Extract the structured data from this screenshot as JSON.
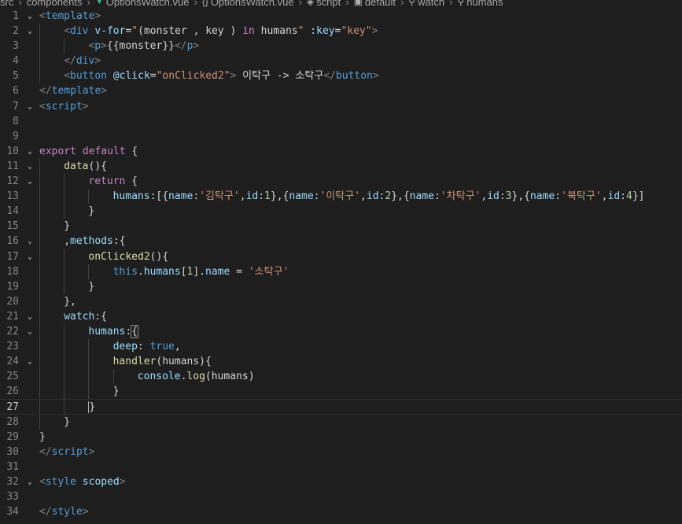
{
  "breadcrumb": [
    "src",
    "components",
    "OptionsWatch.vue",
    "OptionsWatch.vue",
    "script",
    "default",
    "watch",
    "humans"
  ],
  "lines": [
    {
      "n": "1",
      "fold": true,
      "indent": 0,
      "tokens": [
        [
          "br",
          "<"
        ],
        [
          "tag",
          "template"
        ],
        [
          "br",
          ">"
        ]
      ]
    },
    {
      "n": "2",
      "fold": true,
      "indent": 1,
      "tokens": [
        [
          "br",
          "<"
        ],
        [
          "tag",
          "div"
        ],
        [
          "txt",
          " "
        ],
        [
          "attr",
          "v-for"
        ],
        [
          "txt",
          "="
        ],
        [
          "str",
          "\""
        ],
        [
          "txt",
          "(monster , key ) "
        ],
        [
          "kw",
          "in"
        ],
        [
          "txt",
          " humans"
        ],
        [
          "str",
          "\""
        ],
        [
          "txt",
          " "
        ],
        [
          "attr",
          ":key"
        ],
        [
          "txt",
          "="
        ],
        [
          "str",
          "\"key\""
        ],
        [
          "br",
          ">"
        ]
      ]
    },
    {
      "n": "3",
      "fold": false,
      "indent": 2,
      "tokens": [
        [
          "br",
          "<"
        ],
        [
          "tag",
          "p"
        ],
        [
          "br",
          ">"
        ],
        [
          "txt",
          "{{monster}}"
        ],
        [
          "br",
          "</"
        ],
        [
          "tag",
          "p"
        ],
        [
          "br",
          ">"
        ]
      ]
    },
    {
      "n": "4",
      "fold": false,
      "indent": 1,
      "tokens": [
        [
          "br",
          "</"
        ],
        [
          "tag",
          "div"
        ],
        [
          "br",
          ">"
        ]
      ]
    },
    {
      "n": "5",
      "fold": false,
      "indent": 1,
      "tokens": [
        [
          "br",
          "<"
        ],
        [
          "tag",
          "button"
        ],
        [
          "txt",
          " "
        ],
        [
          "attr",
          "@click"
        ],
        [
          "txt",
          "="
        ],
        [
          "str",
          "\"onClicked2\""
        ],
        [
          "br",
          ">"
        ],
        [
          "txt",
          " 이탁구 -> 소탁구"
        ],
        [
          "br",
          "</"
        ],
        [
          "tag",
          "button"
        ],
        [
          "br",
          ">"
        ]
      ]
    },
    {
      "n": "6",
      "fold": false,
      "indent": 0,
      "tokens": [
        [
          "br",
          "</"
        ],
        [
          "tag",
          "template"
        ],
        [
          "br",
          ">"
        ]
      ]
    },
    {
      "n": "7",
      "fold": true,
      "indent": 0,
      "tokens": [
        [
          "br",
          "<"
        ],
        [
          "tag",
          "script"
        ],
        [
          "br",
          ">"
        ]
      ]
    },
    {
      "n": "8",
      "fold": false,
      "indent": 0,
      "tokens": []
    },
    {
      "n": "9",
      "fold": false,
      "indent": 0,
      "tokens": []
    },
    {
      "n": "10",
      "fold": true,
      "indent": 0,
      "tokens": [
        [
          "kw",
          "export"
        ],
        [
          "txt",
          " "
        ],
        [
          "kw",
          "default"
        ],
        [
          "txt",
          " {"
        ]
      ]
    },
    {
      "n": "11",
      "fold": true,
      "indent": 1,
      "tokens": [
        [
          "fn",
          "data"
        ],
        [
          "txt",
          "(){"
        ]
      ]
    },
    {
      "n": "12",
      "fold": true,
      "indent": 2,
      "tokens": [
        [
          "kw",
          "return"
        ],
        [
          "txt",
          " {"
        ]
      ]
    },
    {
      "n": "13",
      "fold": false,
      "indent": 3,
      "tokens": [
        [
          "prop",
          "humans"
        ],
        [
          "txt",
          ":[{"
        ],
        [
          "prop",
          "name"
        ],
        [
          "txt",
          ":"
        ],
        [
          "str",
          "'김탁구'"
        ],
        [
          "txt",
          ","
        ],
        [
          "prop",
          "id"
        ],
        [
          "txt",
          ":"
        ],
        [
          "num",
          "1"
        ],
        [
          "txt",
          "},{"
        ],
        [
          "prop",
          "name"
        ],
        [
          "txt",
          ":"
        ],
        [
          "str",
          "'이탁구'"
        ],
        [
          "txt",
          ","
        ],
        [
          "prop",
          "id"
        ],
        [
          "txt",
          ":"
        ],
        [
          "num",
          "2"
        ],
        [
          "txt",
          "},{"
        ],
        [
          "prop",
          "name"
        ],
        [
          "txt",
          ":"
        ],
        [
          "str",
          "'차탁구'"
        ],
        [
          "txt",
          ","
        ],
        [
          "prop",
          "id"
        ],
        [
          "txt",
          ":"
        ],
        [
          "num",
          "3"
        ],
        [
          "txt",
          "},{"
        ],
        [
          "prop",
          "name"
        ],
        [
          "txt",
          ":"
        ],
        [
          "str",
          "'북탁구'"
        ],
        [
          "txt",
          ","
        ],
        [
          "prop",
          "id"
        ],
        [
          "txt",
          ":"
        ],
        [
          "num",
          "4"
        ],
        [
          "txt",
          "}]"
        ]
      ]
    },
    {
      "n": "14",
      "fold": false,
      "indent": 2,
      "tokens": [
        [
          "txt",
          "}"
        ]
      ]
    },
    {
      "n": "15",
      "fold": false,
      "indent": 1,
      "tokens": [
        [
          "txt",
          "}"
        ]
      ]
    },
    {
      "n": "16",
      "fold": true,
      "indent": 1,
      "tokens": [
        [
          "txt",
          ","
        ],
        [
          "prop",
          "methods"
        ],
        [
          "txt",
          ":{"
        ]
      ]
    },
    {
      "n": "17",
      "fold": true,
      "indent": 2,
      "tokens": [
        [
          "fn",
          "onClicked2"
        ],
        [
          "txt",
          "(){"
        ]
      ]
    },
    {
      "n": "18",
      "fold": false,
      "indent": 3,
      "tokens": [
        [
          "kw2",
          "this"
        ],
        [
          "txt",
          "."
        ],
        [
          "prop",
          "humans"
        ],
        [
          "txt",
          "["
        ],
        [
          "num",
          "1"
        ],
        [
          "txt",
          "]."
        ],
        [
          "prop",
          "name"
        ],
        [
          "txt",
          " = "
        ],
        [
          "str",
          "'소탁구'"
        ]
      ]
    },
    {
      "n": "19",
      "fold": false,
      "indent": 2,
      "tokens": [
        [
          "txt",
          "}"
        ]
      ]
    },
    {
      "n": "20",
      "fold": false,
      "indent": 1,
      "tokens": [
        [
          "txt",
          "},"
        ]
      ]
    },
    {
      "n": "21",
      "fold": true,
      "indent": 1,
      "tokens": [
        [
          "prop",
          "watch"
        ],
        [
          "txt",
          ":{"
        ]
      ]
    },
    {
      "n": "22",
      "fold": true,
      "indent": 2,
      "tokens": [
        [
          "prop",
          "humans"
        ],
        [
          "txt",
          ":"
        ],
        [
          "match",
          "{"
        ]
      ]
    },
    {
      "n": "23",
      "fold": false,
      "indent": 3,
      "tokens": [
        [
          "prop",
          "deep"
        ],
        [
          "txt",
          ": "
        ],
        [
          "kw2",
          "true"
        ],
        [
          "txt",
          ","
        ]
      ]
    },
    {
      "n": "24",
      "fold": true,
      "indent": 3,
      "tokens": [
        [
          "fn",
          "handler"
        ],
        [
          "txt",
          "(humans){"
        ]
      ]
    },
    {
      "n": "25",
      "fold": false,
      "indent": 4,
      "tokens": [
        [
          "prop",
          "console"
        ],
        [
          "txt",
          "."
        ],
        [
          "fn",
          "log"
        ],
        [
          "txt",
          "(humans)"
        ]
      ]
    },
    {
      "n": "26",
      "fold": false,
      "indent": 3,
      "tokens": [
        [
          "txt",
          "}"
        ]
      ]
    },
    {
      "n": "27",
      "fold": false,
      "indent": 2,
      "current": true,
      "tokens": [
        [
          "cursor",
          "}"
        ]
      ]
    },
    {
      "n": "28",
      "fold": false,
      "indent": 1,
      "tokens": [
        [
          "txt",
          "}"
        ]
      ]
    },
    {
      "n": "29",
      "fold": false,
      "indent": 0,
      "tokens": [
        [
          "txt",
          "}"
        ]
      ]
    },
    {
      "n": "30",
      "fold": false,
      "indent": 0,
      "tokens": [
        [
          "br",
          "</"
        ],
        [
          "tag",
          "script"
        ],
        [
          "br",
          ">"
        ]
      ]
    },
    {
      "n": "31",
      "fold": false,
      "indent": 0,
      "tokens": []
    },
    {
      "n": "32",
      "fold": true,
      "indent": 0,
      "tokens": [
        [
          "br",
          "<"
        ],
        [
          "tag",
          "style"
        ],
        [
          "txt",
          " "
        ],
        [
          "attr",
          "scoped"
        ],
        [
          "br",
          ">"
        ]
      ]
    },
    {
      "n": "33",
      "fold": false,
      "indent": 0,
      "tokens": []
    },
    {
      "n": "34",
      "fold": false,
      "indent": 0,
      "tokens": [
        [
          "br",
          "</"
        ],
        [
          "tag",
          "style"
        ],
        [
          "br",
          ">"
        ]
      ]
    }
  ]
}
